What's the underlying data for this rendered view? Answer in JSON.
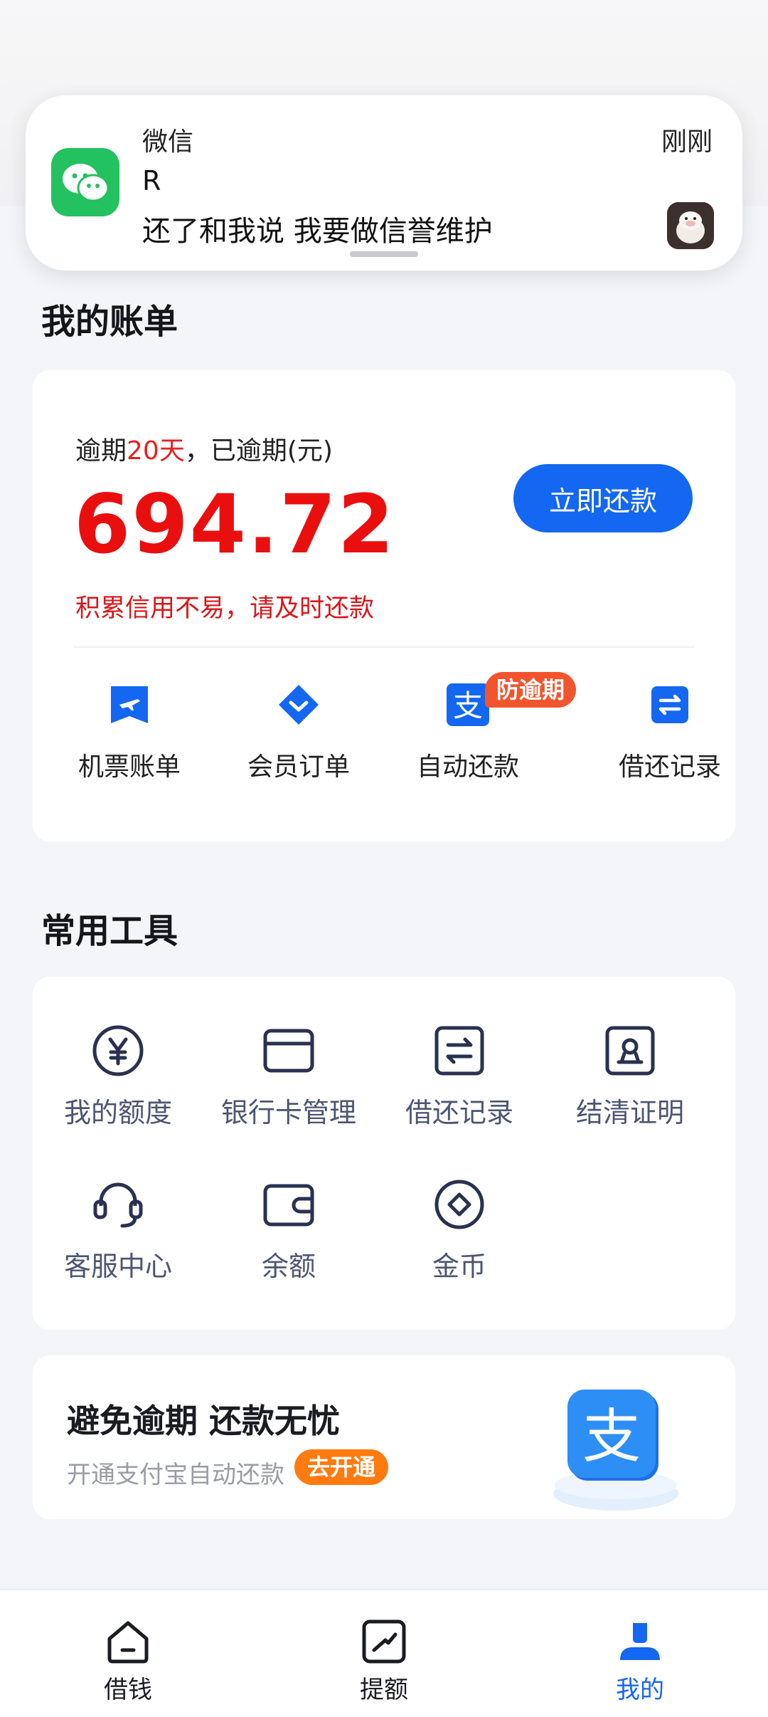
{
  "notification": {
    "app": "微信",
    "time": "刚刚",
    "sender": "R",
    "message": "还了和我说 我要做信誉维护",
    "app_icon": "wechat-icon"
  },
  "bill": {
    "section_title": "我的账单",
    "overdue_prefix": "逾期",
    "overdue_days": "20天",
    "overdue_suffix": "，已逾期(元)",
    "amount": "694.72",
    "repay_button": "立即还款",
    "tip": "积累信用不易，请及时还款",
    "quick_items": [
      {
        "label": "机票账单",
        "icon": "plane-ticket-icon"
      },
      {
        "label": "会员订单",
        "icon": "diamond-icon"
      },
      {
        "label": "自动还款",
        "icon": "alipay-icon",
        "badge": "防逾期"
      },
      {
        "label": "借还记录",
        "icon": "transfer-icon"
      }
    ]
  },
  "tools": {
    "section_title": "常用工具",
    "items": [
      {
        "label": "我的额度",
        "icon": "yuan-icon"
      },
      {
        "label": "银行卡管理",
        "icon": "bank-card-icon"
      },
      {
        "label": "借还记录",
        "icon": "transfer-record-icon"
      },
      {
        "label": "结清证明",
        "icon": "certificate-icon"
      },
      {
        "label": "客服中心",
        "icon": "headset-icon"
      },
      {
        "label": "余额",
        "icon": "wallet-icon"
      },
      {
        "label": "金币",
        "icon": "coin-icon"
      }
    ]
  },
  "promo": {
    "title": "避免逾期 还款无忧",
    "subtitle": "开通支付宝自动还款",
    "button": "去开通"
  },
  "bottom_nav": {
    "items": [
      {
        "label": "借钱",
        "icon": "home-icon",
        "active": false
      },
      {
        "label": "提额",
        "icon": "boost-icon",
        "active": false
      },
      {
        "label": "我的",
        "icon": "profile-icon",
        "active": true
      }
    ]
  },
  "colors": {
    "accent": "#1467f0",
    "overdue_red": "#ea0f0f",
    "badge_orange": "#f2542d",
    "promo_orange": "#ff7a0f",
    "wechat_green": "#23c160"
  }
}
